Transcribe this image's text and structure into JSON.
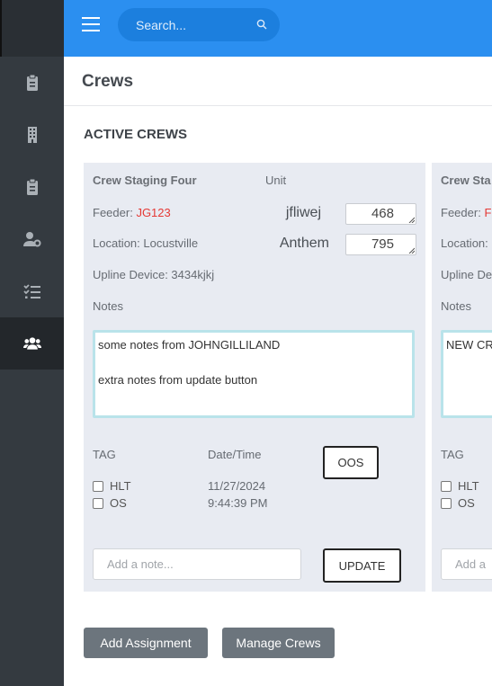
{
  "search": {
    "placeholder": "Search..."
  },
  "page": {
    "title": "Crews",
    "section_title": "ACTIVE CREWS"
  },
  "sidebar": {
    "items": [
      {
        "icon": "clipboard-icon"
      },
      {
        "icon": "building-icon"
      },
      {
        "icon": "clipboard-icon"
      },
      {
        "icon": "user-gear-icon"
      },
      {
        "icon": "checklist-icon"
      },
      {
        "icon": "users-icon",
        "active": true
      }
    ]
  },
  "crews": [
    {
      "name": "Crew Staging Four",
      "unit_label": "Unit",
      "feeder_label": "Feeder:",
      "feeder_value": "JG123",
      "location": "Location: Locustville",
      "upline": "Upline Device: 3434kjkj",
      "notes_label": "Notes",
      "notes_text": "some notes from JOHNGILLILAND\n\nextra notes from update button",
      "units": [
        {
          "name": "jfliwej",
          "value": "468"
        },
        {
          "name": "Anthem",
          "value": "795"
        }
      ],
      "tag_label": "TAG",
      "datetime_label": "Date/Time",
      "tags": [
        "HLT",
        "OS"
      ],
      "date": "11/27/2024",
      "time": "9:44:39 PM",
      "oos_label": "OOS",
      "update_label": "UPDATE",
      "add_note_placeholder": "Add a note..."
    },
    {
      "name": "Crew Sta",
      "feeder_label": "Feeder:",
      "feeder_value": "F",
      "location": "Location:",
      "upline": "Upline De",
      "notes_label": "Notes",
      "notes_text": "NEW CR",
      "tag_label": "TAG",
      "tags": [
        "HLT",
        "OS"
      ],
      "add_note_placeholder": "Add a"
    }
  ],
  "actions": {
    "add_assignment": "Add Assignment",
    "manage_crews": "Manage Crews"
  },
  "colors": {
    "topbar": "#2b8ff0",
    "sidebar": "#343a40",
    "feeder_red": "#e53935",
    "notes_border": "#b9e3ea"
  }
}
